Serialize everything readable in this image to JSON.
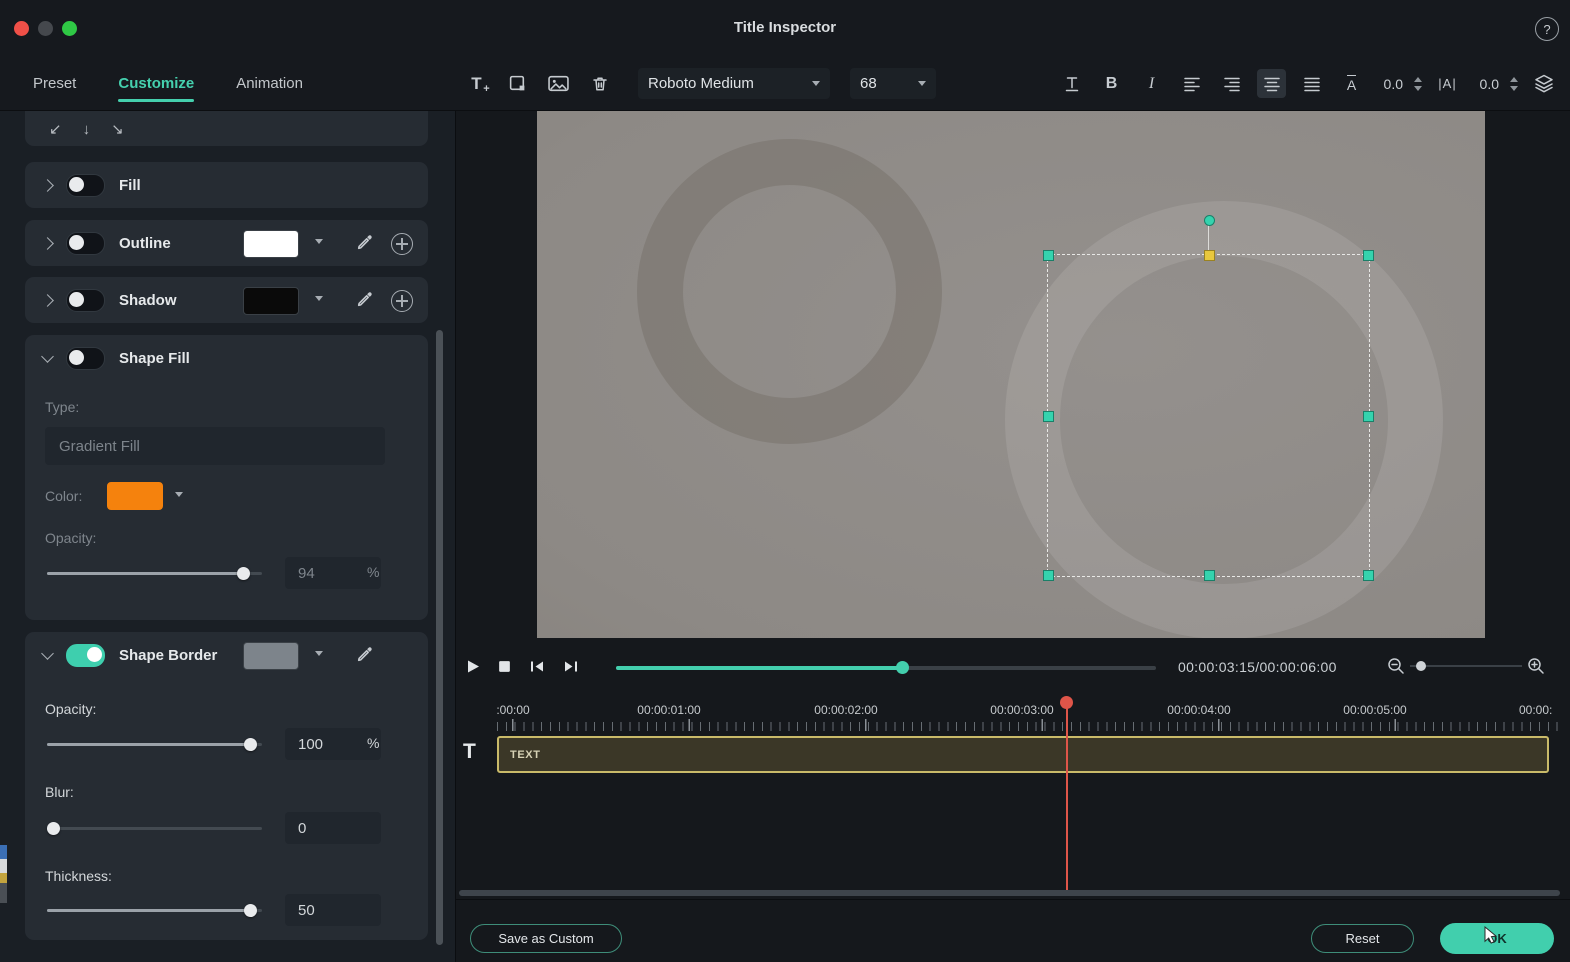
{
  "titlebar": {
    "title": "Title Inspector",
    "help_label": "?"
  },
  "tabs": {
    "preset": "Preset",
    "customize": "Customize",
    "animation": "Animation"
  },
  "toolbar": {
    "add_text_label": "T",
    "add_plus_label": "+",
    "font_name": "Roboto Medium",
    "font_size": "68",
    "bold_label": "B",
    "italic_label": "I",
    "letter_case_label": "A",
    "letter_width_label": "|A|",
    "char_spacing_value": "0.0",
    "line_spacing_value": "0.0"
  },
  "panel": {
    "align_icons": [
      "↙",
      "↓",
      "↘"
    ],
    "fill_label": "Fill",
    "outline_label": "Outline",
    "shadow_label": "Shadow",
    "shape_fill": {
      "label": "Shape Fill",
      "type_label": "Type:",
      "type_value": "Gradient Fill",
      "color_label": "Color:",
      "color": "#f5820d",
      "opacity_label": "Opacity:",
      "opacity_value": "94",
      "opacity_unit": "%"
    },
    "shape_border": {
      "label": "Shape Border",
      "color": "#7d848b",
      "opacity_label": "Opacity:",
      "opacity_value": "100",
      "opacity_unit": "%",
      "blur_label": "Blur:",
      "blur_value": "0",
      "thickness_label": "Thickness:",
      "thickness_value": "50"
    },
    "swatch_colors": {
      "outline": "#ffffff",
      "shadow": "#0a0a0a",
      "fill": "#f5820d",
      "border": "#7d848b"
    }
  },
  "player": {
    "timecode": "00:00:03:15/00:00:06:00"
  },
  "timeline": {
    "ticks": [
      ":00:00",
      "00:00:01:00",
      "00:00:02:00",
      "00:00:03:00",
      "00:00:04:00",
      "00:00:05:00",
      "00:00:"
    ],
    "track_icon": "T",
    "clip_label": "TEXT"
  },
  "footer": {
    "save_label": "Save as Custom",
    "reset_label": "Reset",
    "ok_label": "OK"
  },
  "accent_color": "#41cfad",
  "playhead_color": "#df5549"
}
